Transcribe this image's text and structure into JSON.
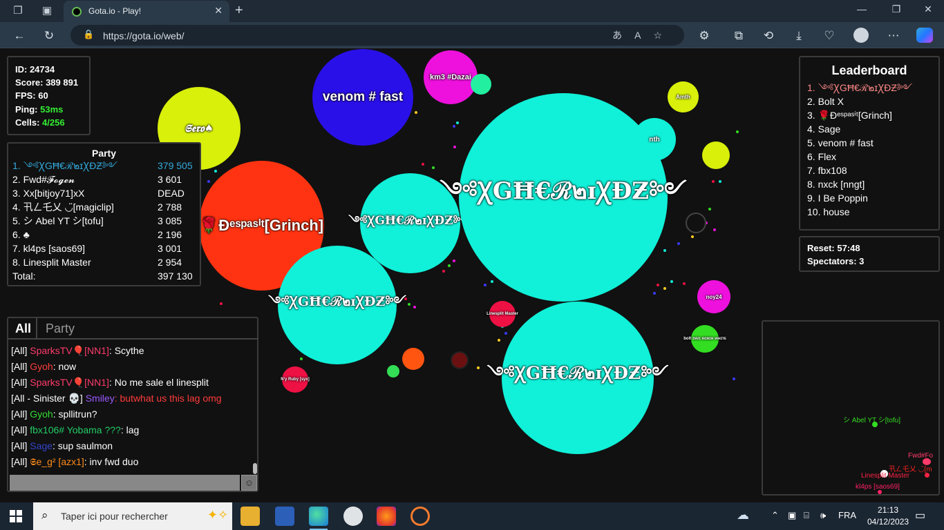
{
  "browser": {
    "tab_title": "Gota.io - Play!",
    "url": "https://gota.io/web/"
  },
  "stats": {
    "id": "ID: 24734",
    "score": "Score: 389 891",
    "fps": "FPS: 60",
    "ping_label": "Ping: ",
    "ping_value": "53ms",
    "cells_label": "Cells: ",
    "cells_value": "4/256"
  },
  "party": {
    "title": "Party",
    "rows": [
      {
        "name": "1. ༺ꞳGĦ€ℛ๒ɪꞳĐƵ༻",
        "value": "379 505"
      },
      {
        "name": "2. Fwd#𝓕𝓸𝓰𝓮𝓷",
        "value": "3 601"
      },
      {
        "name": "3. Xx[bitjoy71]xX",
        "value": "DEAD"
      },
      {
        "name": "4. 卂ㄥ乇乂 ◡̈[magiclip]",
        "value": "2 788"
      },
      {
        "name": "5. シ Abel YT シ[tofu]",
        "value": "3 085"
      },
      {
        "name": "6. ♣",
        "value": "2 196"
      },
      {
        "name": "7. kl4ps [saos69]",
        "value": "3 001"
      },
      {
        "name": "8. Linesplit Master",
        "value": "2 954"
      }
    ],
    "total_label": "Total:",
    "total_value": "397 130"
  },
  "leaderboard": {
    "title": "Leaderboard",
    "entries": [
      "1. ༺ꞳGĦ€ℛ๒ɪꞳĐƵ༻",
      "2. Bolt X",
      "3. 🌹Đᵉˢᵖᵃˢⁱᵗ[Grinch]",
      "4. Sage",
      "5. venom # fast",
      "6. Flex",
      "7. fbx108",
      "8. nxck [nngt]",
      "9. I Be Poppin",
      "10. house"
    ]
  },
  "server": {
    "reset": "Reset: 57:48",
    "spectators": "Spectators: 3"
  },
  "chat": {
    "tab_all": "All",
    "tab_party": "Party",
    "lines": [
      {
        "prefix": "[All] ",
        "name": "SparksTV🎈[NN1]",
        "name_color": "#ff3b6b",
        "msg": ": Scythe",
        "msg_color": "#ffffff"
      },
      {
        "prefix": "[All] ",
        "name": "Gyoh",
        "name_color": "#ff3b3b",
        "msg": ": now",
        "msg_color": "#ffffff"
      },
      {
        "prefix": "[All] ",
        "name": "SparksTV🎈[NN1]",
        "name_color": "#ff3b6b",
        "msg": ": No me sale el linesplit",
        "msg_color": "#ffffff"
      },
      {
        "prefix": "[All - Sinister 💀] ",
        "name": "Smiley",
        "name_color": "#9b59ff",
        "msg": ": butwhat us this lag omg",
        "msg_color": "#ff3b3b"
      },
      {
        "prefix": "[All] ",
        "name": "Gyoh",
        "name_color": "#33dd33",
        "msg": ": spllitrun?",
        "msg_color": "#ffffff"
      },
      {
        "prefix": "[All] ",
        "name": "fbx106# Yobama ???",
        "name_color": "#22cc66",
        "msg": ": lag",
        "msg_color": "#ffffff"
      },
      {
        "prefix": "[All] ",
        "name": "Sage",
        "name_color": "#3344cc",
        "msg": ": sup saulmon",
        "msg_color": "#ffffff"
      },
      {
        "prefix": "[All] ",
        "name": "𝕾e_g² [azx1]",
        "name_color": "#ff8c1a",
        "msg": ": inv fwd duo",
        "msg_color": "#ffffff"
      }
    ]
  },
  "cells": [
    {
      "label": "𝕾𝖊𝖗𝖔♠",
      "color": "#d8f00a"
    },
    {
      "label": "venom # fast",
      "color": "#2a10e8"
    },
    {
      "label": "km3 #Dazai",
      "color": "#ee11dd"
    },
    {
      "label": "🌹Đᵉˢᵖᵃˢⁱᵗ[Grinch]",
      "color": "#ff3311"
    },
    {
      "label": "༺ꞳGĦ€ℛ๒ɪꞳĐƵ༻",
      "color": "#11f0d8"
    },
    {
      "label": "༺ꞳGĦ€ℛ๒ɪꞳĐƵ༻",
      "color": "#11f0d8"
    },
    {
      "label": "༺ꞳGĦ€ℛ๒ɪꞳĐƵ༻",
      "color": "#11f0d8"
    },
    {
      "label": "༺ꞳGĦ€ℛ๒ɪꞳĐƵ༻",
      "color": "#11f0d8"
    },
    {
      "label": "Amth",
      "color": "#d8f00a"
    },
    {
      "label": "nth",
      "color": "#11f0d8"
    },
    {
      "label": "noy24",
      "color": "#ee11dd"
    },
    {
      "label": "Linesplit Master",
      "color": "#ee1144"
    },
    {
      "label": "N'y Ruby [syx]",
      "color": "#ee1144"
    },
    {
      "label": "bolt ɪɴᴠɪ ʀᴏɴɪɴ ᴡʜɪᴛᴇ",
      "color": "#33dd22"
    }
  ],
  "minimap": {
    "labels": [
      {
        "text": "シ Abel YT シ[tofu]",
        "color": "#33dd22"
      },
      {
        "text": "Fwd#Fo",
        "color": "#ff3b6b"
      },
      {
        "text": "卂ㄥ乇乂 ◡̈[m",
        "color": "#ff2222"
      },
      {
        "text": "Linesplit Master",
        "color": "#ff2244"
      },
      {
        "text": "kl4ps [saos69]",
        "color": "#ff2266"
      }
    ]
  },
  "taskbar": {
    "search_placeholder": "Taper ici pour rechercher",
    "lang": "FRA",
    "time": "21:13",
    "date": "04/12/2023"
  }
}
